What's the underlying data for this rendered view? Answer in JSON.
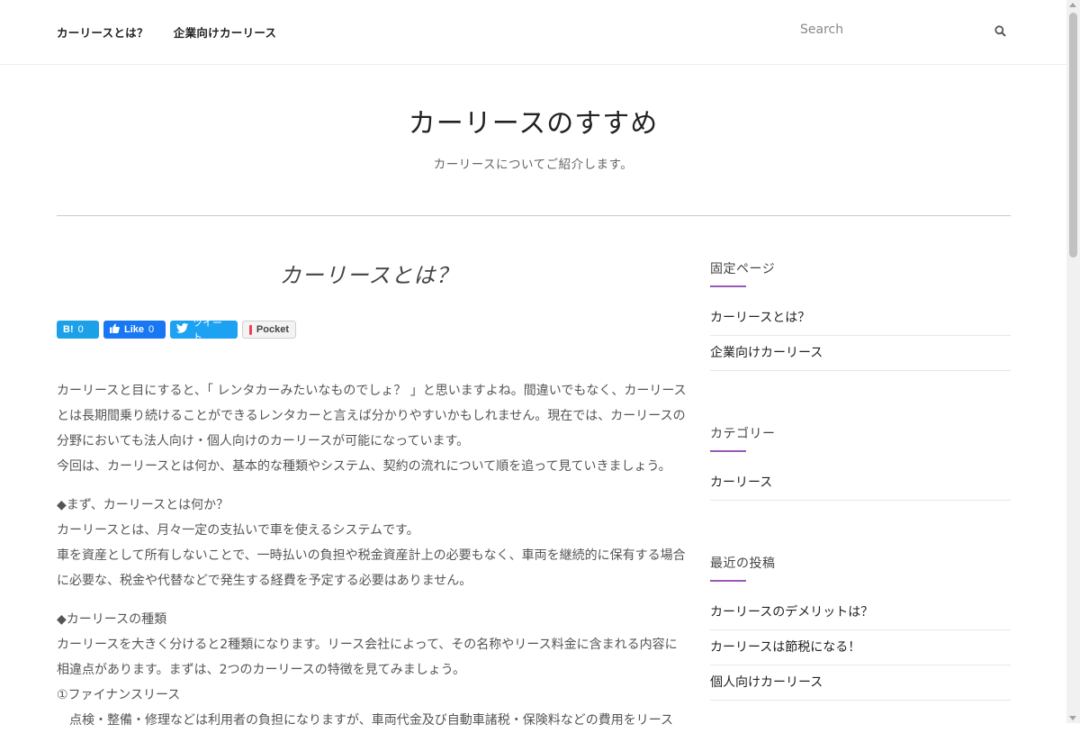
{
  "nav": {
    "items": [
      {
        "label": "カーリースとは？"
      },
      {
        "label": "企業向けカーリース"
      }
    ]
  },
  "search": {
    "placeholder": "Search",
    "icon": "search-icon"
  },
  "site": {
    "title": "カーリースのすすめ",
    "description": "カーリースについてご紹介します。"
  },
  "post": {
    "title": "カーリースとは？",
    "share": {
      "hatena_label": "B!",
      "hatena_count": "0",
      "fb_label": "Like",
      "fb_count": "0",
      "tw_label": "ツイート",
      "pocket_label": "Pocket"
    },
    "paragraphs": [
      "カーリースと目にすると、「 レンタカーみたいなものでしょ？ 」と思いますよね。間違いでもなく、カーリースとは長期間乗り続けることができるレンタカーと言えば分かりやすいかもしれません。現在では、カーリースの分野においても法人向け・個人向けのカーリースが可能になっています。",
      "今回は、カーリースとは何か、基本的な種類やシステム、契約の流れについて順を追って見ていきましょう。",
      "◆まず、カーリースとは何か？",
      "カーリースとは、月々一定の支払いで車を使えるシステムです。",
      "車を資産として所有しないことで、一時払いの負担や税金資産計上の必要もなく、車両を継続的に保有する場合に必要な、税金や代替などで発生する経費を予定する必要はありません。",
      "◆カーリースの種類",
      "カーリースを大きく分けると2種類になります。リース会社によって、その名称やリース料金に含まれる内容に相違点があります。まずは、2つのカーリースの特徴を見てみましょう。",
      "①ファイナンスリース",
      "　点検・整備・修理などは利用者の負担になりますが、車両代金及び自動車諸税・保険料などの費用をリース"
    ]
  },
  "sidebar": {
    "pages": {
      "title": "固定ページ",
      "items": [
        "カーリースとは？",
        "企業向けカーリース"
      ]
    },
    "categories": {
      "title": "カテゴリー",
      "items": [
        "カーリース"
      ]
    },
    "recent": {
      "title": "最近の投稿",
      "items": [
        "カーリースのデメリットは？",
        "カーリースは節税になる！",
        "個人向けカーリース"
      ]
    }
  },
  "colors": {
    "accent": "#9b59b6",
    "hatena": "#1ca1e8",
    "facebook": "#1877f2",
    "twitter": "#1da1f2",
    "pocket": "#ef4056"
  }
}
